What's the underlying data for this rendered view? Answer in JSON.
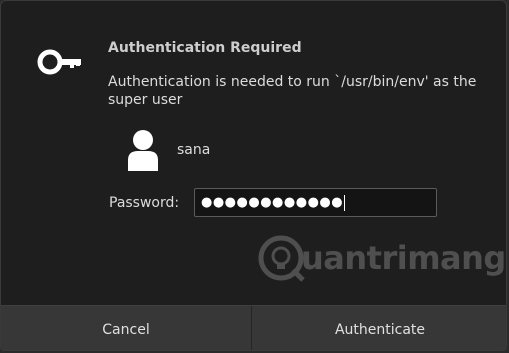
{
  "dialog": {
    "title": "Authentication Required",
    "message": "Authentication is needed to run `/usr/bin/env' as the super user",
    "user": {
      "name": "sana",
      "icon": "user-avatar-icon"
    },
    "password": {
      "label": "Password:",
      "masked_value": "●●●●●●●●●●●●",
      "icon": "key-icon"
    },
    "buttons": {
      "cancel": "Cancel",
      "authenticate": "Authenticate"
    }
  },
  "watermark": {
    "text": "uantrimang"
  },
  "colors": {
    "background": "#1e1e1e",
    "button": "#373737",
    "text": "#dcdcdc",
    "field_bg": "#141414"
  }
}
